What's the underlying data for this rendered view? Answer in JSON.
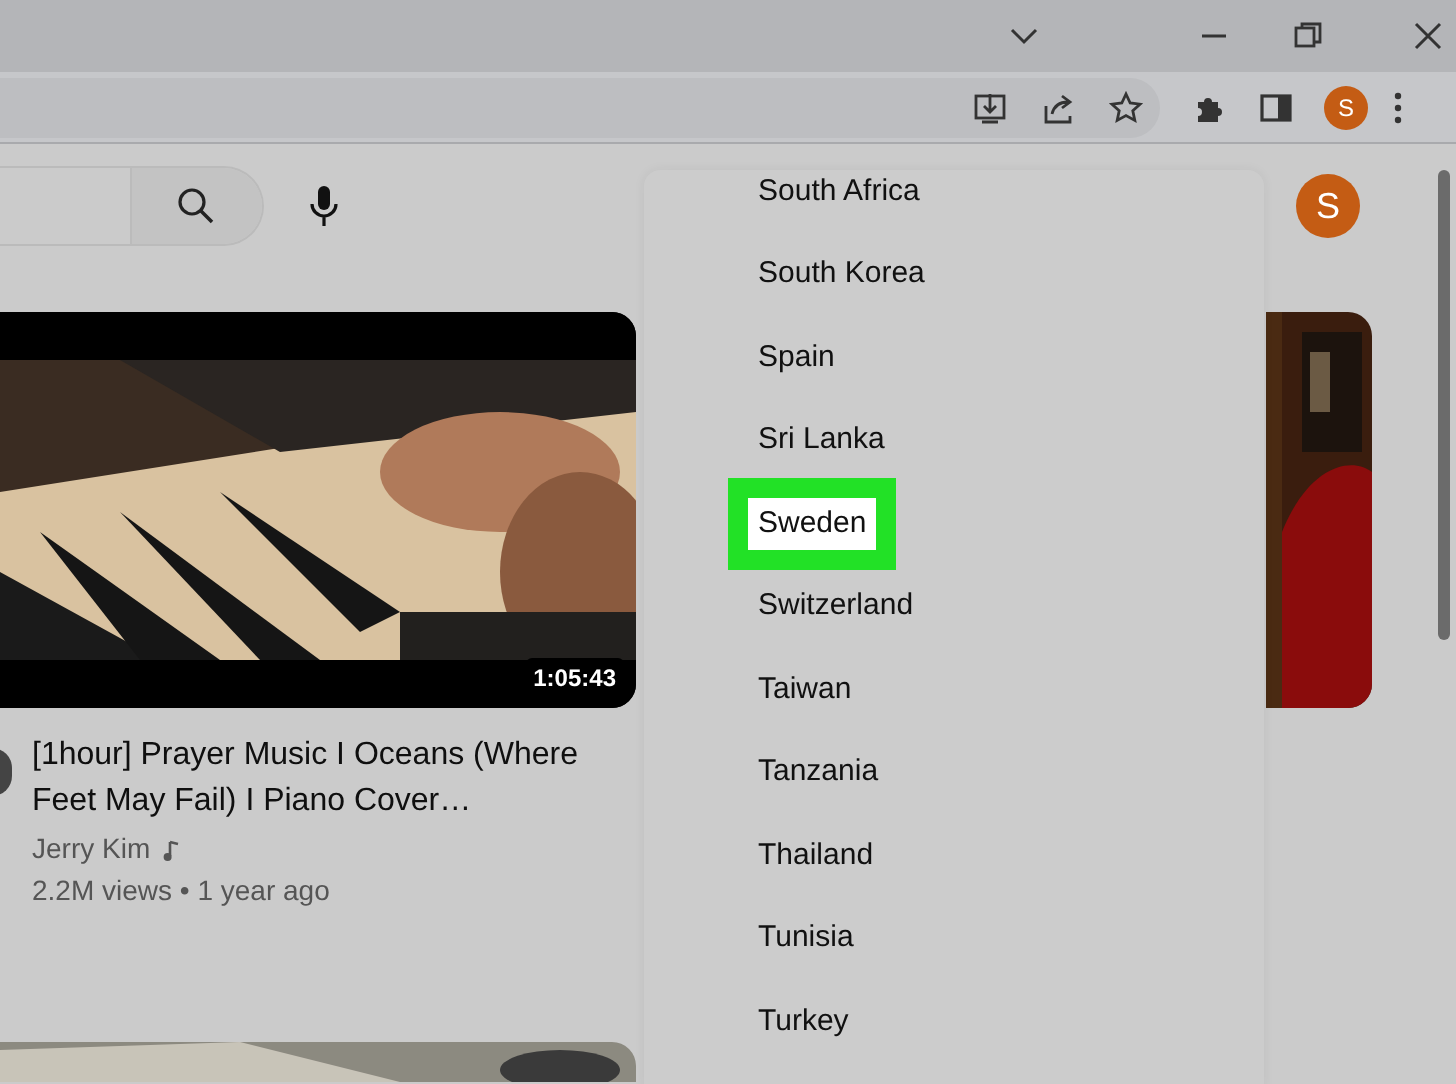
{
  "toolbar": {
    "profile_letter": "S"
  },
  "header": {
    "avatar_letter": "S"
  },
  "video": {
    "duration": "1:05:43",
    "title": "[1hour] Prayer Music I Oceans (Where Feet May Fail) I Piano Cover…",
    "channel": "Jerry Kim",
    "meta": "2.2M views • 1 year ago"
  },
  "country_menu": {
    "items": [
      {
        "label": "South Africa",
        "selected": false
      },
      {
        "label": "South Korea",
        "selected": false
      },
      {
        "label": "Spain",
        "selected": false
      },
      {
        "label": "Sri Lanka",
        "selected": false
      },
      {
        "label": "Sweden",
        "selected": true
      },
      {
        "label": "Switzerland",
        "selected": false
      },
      {
        "label": "Taiwan",
        "selected": false
      },
      {
        "label": "Tanzania",
        "selected": false
      },
      {
        "label": "Thailand",
        "selected": false
      },
      {
        "label": "Tunisia",
        "selected": false
      },
      {
        "label": "Turkey",
        "selected": false
      }
    ]
  }
}
